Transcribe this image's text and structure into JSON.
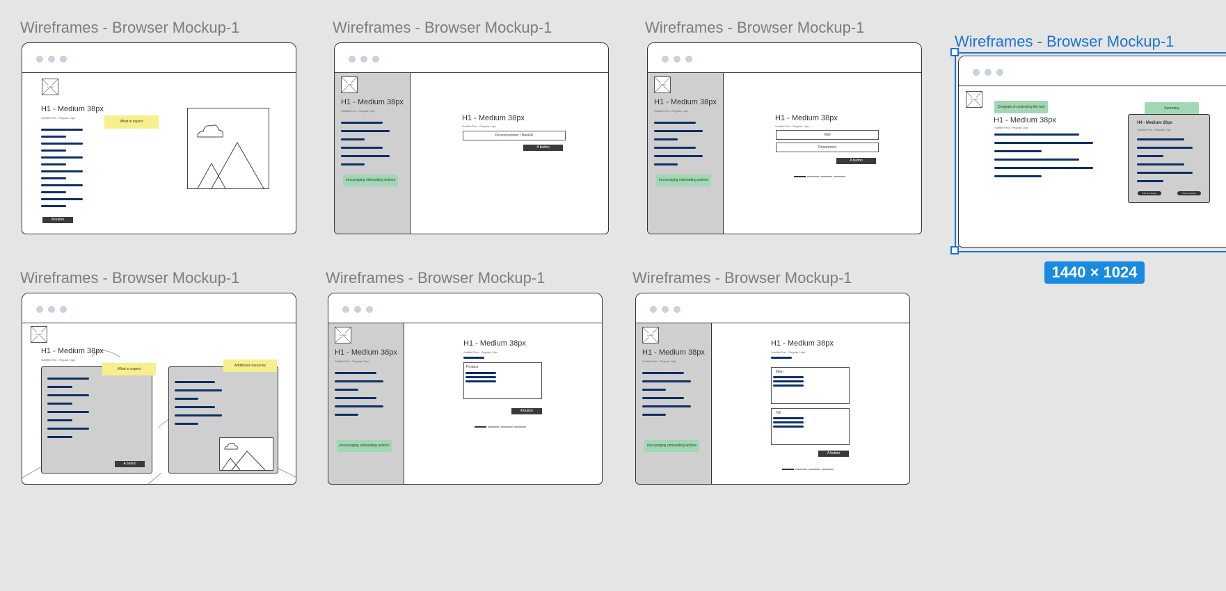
{
  "frames": [
    {
      "title": "Wireframes - Browser Mockup-1"
    },
    {
      "title": "Wireframes - Browser Mockup-1"
    },
    {
      "title": "Wireframes - Browser Mockup-1"
    },
    {
      "title": "Wireframes - Browser Mockup-1"
    },
    {
      "title": "Wireframes - Browser Mockup-1"
    },
    {
      "title": "Wireframes - Browser Mockup-1"
    },
    {
      "title": "Wireframes - Browser Mockup-1"
    }
  ],
  "common": {
    "logo": "Logo",
    "h1": "H1 - Medium 38px",
    "subtitle": "Subtitle/Text - Regular 14px",
    "button": "A button",
    "sidebar_action": "encouraging onboarding actions"
  },
  "f1": {
    "sticky": "What to expect"
  },
  "f2": {
    "field": "Personnummer / BankID"
  },
  "f3": {
    "field1": "Mail",
    "field2": "Department"
  },
  "f4": {
    "sticky_left": "Congrats on activating the tool",
    "sticky_right": "Summary",
    "card_title": "H4 - Medium 20px",
    "card_subtitle": "Subtitle/Text - Regular 14px",
    "pill1": "This is a button",
    "pill2": "This is a button"
  },
  "f5": {
    "sticky_left": "What to expect",
    "sticky_right": "Additional resources"
  },
  "f6": {
    "box_label": "Product"
  },
  "f7": {
    "box1_label": "Main",
    "box2_label": "Tell"
  },
  "selection": {
    "size": "1440 × 1024"
  }
}
